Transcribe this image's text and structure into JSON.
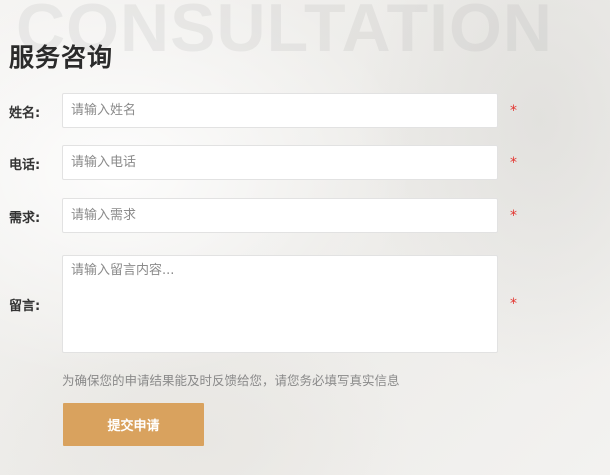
{
  "page": {
    "watermark": "CONSULTATION",
    "title": "服务咨询"
  },
  "form": {
    "name": {
      "label": "姓名:",
      "placeholder": "请输入姓名",
      "value": "",
      "required_mark": "*"
    },
    "phone": {
      "label": "电话:",
      "placeholder": "请输入电话",
      "value": "",
      "required_mark": "*"
    },
    "demand": {
      "label": "需求:",
      "placeholder": "请输入需求",
      "value": "",
      "required_mark": "*"
    },
    "message": {
      "label": "留言:",
      "placeholder": "请输入留言内容...",
      "value": "",
      "required_mark": "*"
    },
    "notice": "为确保您的申请结果能及时反馈给您，请您务必填写真实信息",
    "submit_label": "提交申请"
  },
  "colors": {
    "accent": "#d9a25e",
    "required": "#e3342f",
    "title": "#2b2b2b"
  }
}
